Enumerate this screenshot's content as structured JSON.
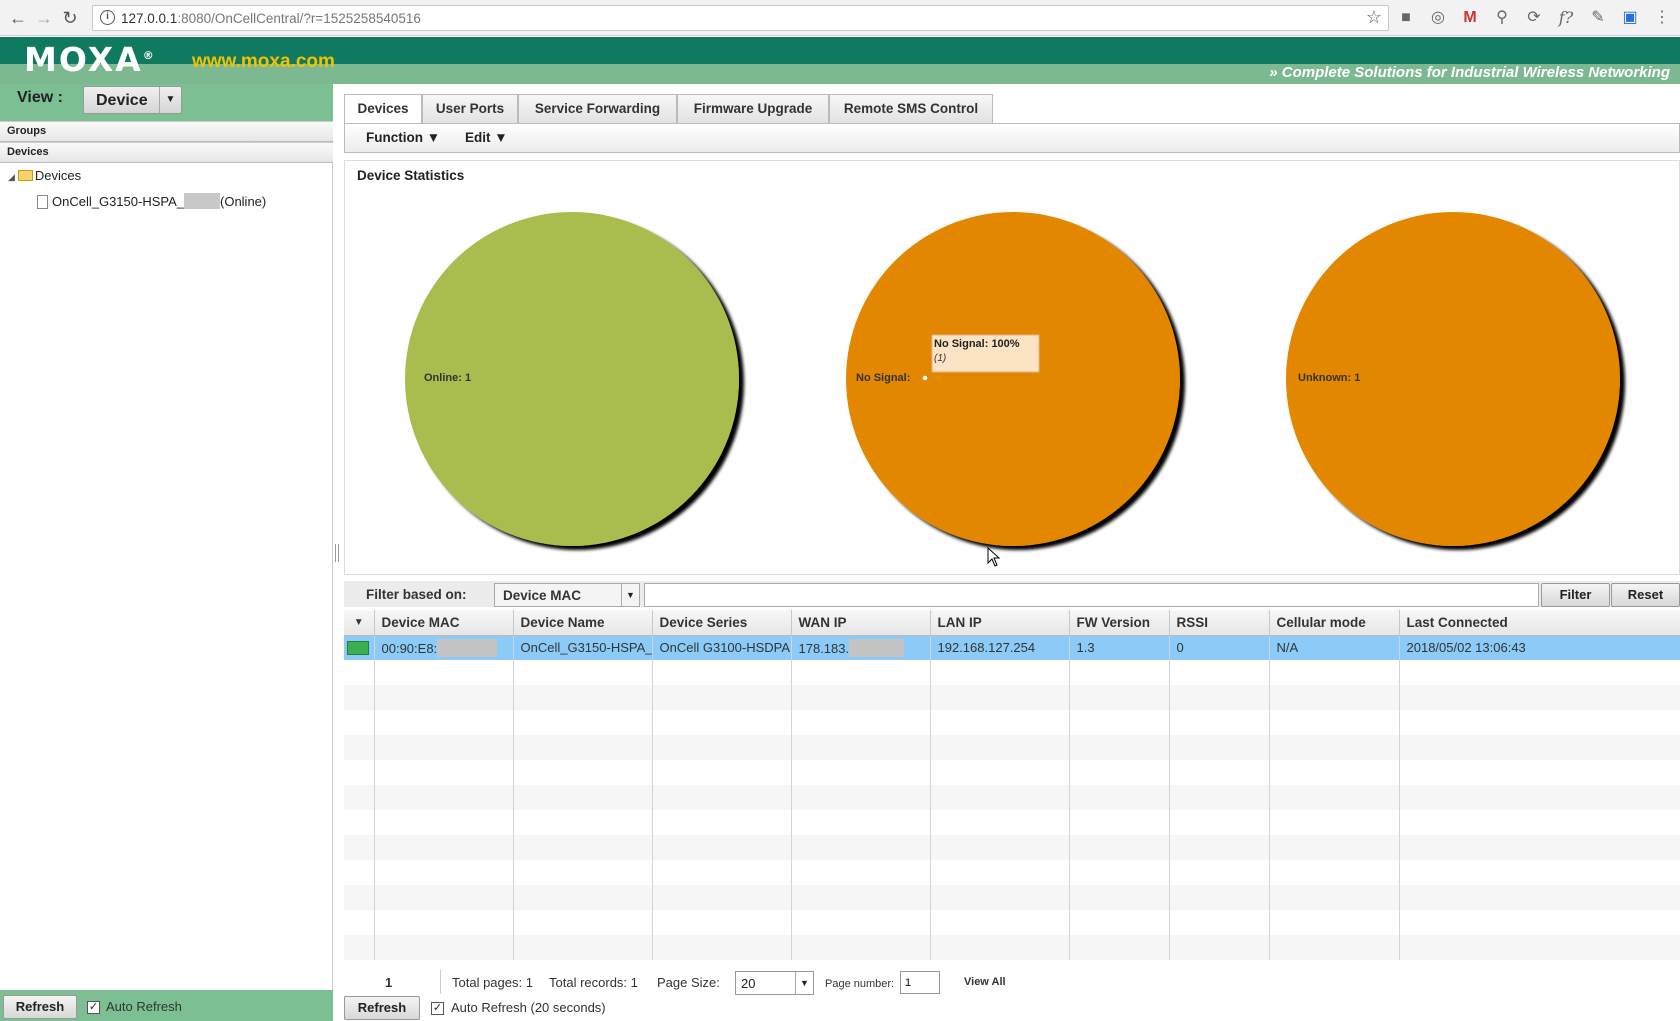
{
  "browser": {
    "url_host": "127.0.0.1",
    "url_rest": ":8080/OnCellCentral/?r=1525258540516"
  },
  "header": {
    "logo": "MOXA",
    "site": "www.moxa.com",
    "tagline": "Complete Solutions for Industrial Wireless Networking"
  },
  "sidebar": {
    "view_label": "View :",
    "view_value": "Device",
    "sections": [
      "Groups",
      "Devices"
    ],
    "tree_root": "Devices",
    "tree_child_prefix": "OnCell_G3150-HSPA_",
    "tree_child_suffix": "(Online)",
    "refresh_label": "Refresh",
    "auto_refresh_label": "Auto Refresh"
  },
  "tabs": [
    "Devices",
    "User Ports",
    "Service Forwarding",
    "Firmware Upgrade",
    "Remote SMS Control"
  ],
  "toolbar": {
    "function_label": "Function ▼",
    "edit_label": "Edit ▼"
  },
  "stats": {
    "title": "Device Statistics"
  },
  "chart_data": [
    {
      "type": "pie",
      "slices": [
        {
          "label": "Online",
          "value": 1,
          "color": "#a8bd4e"
        }
      ],
      "labels_text": [
        "Online: 1"
      ]
    },
    {
      "type": "pie",
      "slices": [
        {
          "label": "No Signal",
          "value": 1,
          "color": "#e38603"
        }
      ],
      "labels_text": [
        "No Signal:"
      ],
      "tooltip": {
        "line1": "No Signal:  100%",
        "line2": "(1)"
      }
    },
    {
      "type": "pie",
      "slices": [
        {
          "label": "Unknown",
          "value": 1,
          "color": "#e38603"
        }
      ],
      "labels_text": [
        "Unknown: 1"
      ]
    }
  ],
  "filter": {
    "label": "Filter based on:",
    "field": "Device MAC",
    "value": "",
    "filter_button": "Filter",
    "reset_button": "Reset"
  },
  "grid": {
    "headers": [
      "▼",
      "Device MAC",
      "Device Name",
      "Device Series",
      "WAN IP",
      "LAN IP",
      "FW Version",
      "RSSI",
      "Cellular mode",
      "Last Connected"
    ],
    "rows": [
      {
        "mac": "00:90:E8:",
        "name": "OnCell_G3150-HSPA_",
        "series": "OnCell G3100-HSDPA",
        "wan": "178.183.",
        "lan": "192.168.127.254",
        "fw": "1.3",
        "rssi": "0",
        "cell": "N/A",
        "last": "2018/05/02 13:06:43"
      }
    ]
  },
  "pager": {
    "current_page": "1",
    "total_pages": "Total pages: 1",
    "total_records": "Total records: 1",
    "page_size_label": "Page Size:",
    "page_size": "20",
    "page_number_label": "Page number:",
    "page_number": "1",
    "view_all": "View All",
    "refresh_label": "Refresh",
    "auto_refresh_label": "Auto Refresh (20 seconds)"
  }
}
